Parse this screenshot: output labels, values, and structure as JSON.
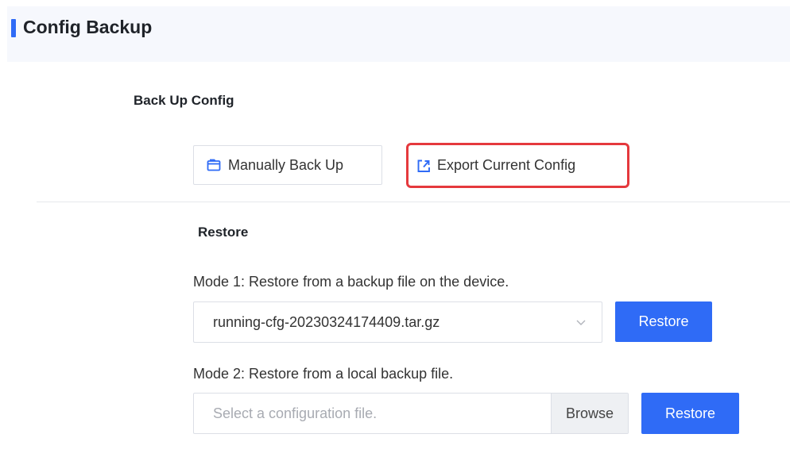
{
  "header": {
    "title": "Config Backup"
  },
  "backup": {
    "title": "Back Up Config",
    "manual_label": "Manually Back Up",
    "export_label": "Export Current Config"
  },
  "restore": {
    "title": "Restore",
    "mode1_label": "Mode 1: Restore from a backup file on the device.",
    "mode1_selected": "running-cfg-20230324174409.tar.gz",
    "mode1_button": "Restore",
    "mode2_label": "Mode 2: Restore from a local backup file.",
    "mode2_placeholder": "Select a configuration file.",
    "browse_label": "Browse",
    "mode2_button": "Restore"
  },
  "icons": {
    "manual": "folder-icon",
    "export": "export-icon",
    "select": "chevron-down-icon"
  },
  "colors": {
    "accent": "#2f6bf6",
    "highlight": "#e5393d",
    "header_bg": "#f6f8fd"
  }
}
